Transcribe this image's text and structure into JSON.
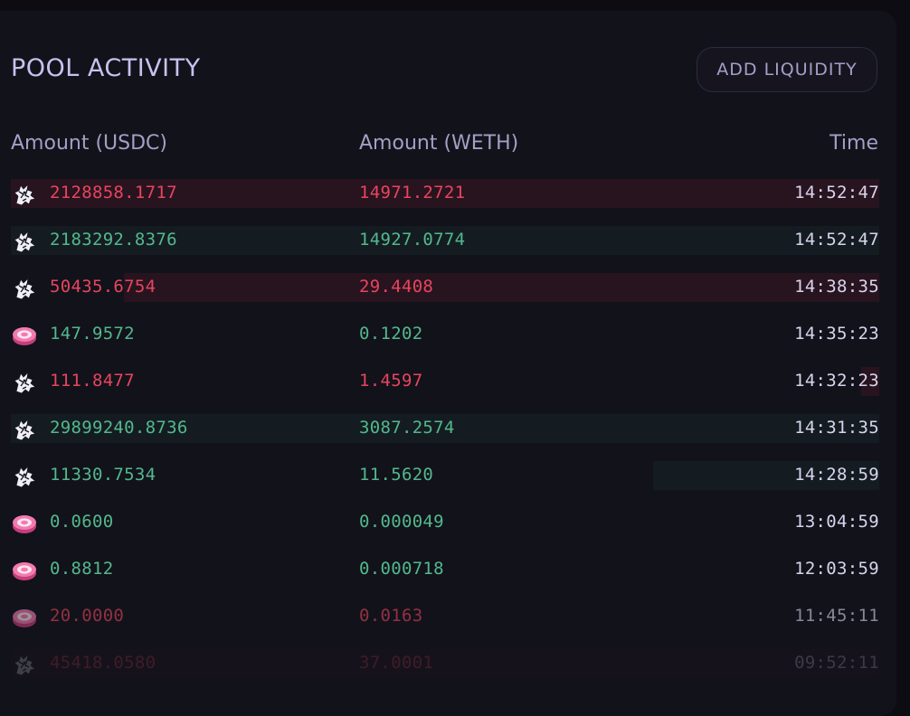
{
  "header": {
    "title": "POOL ACTIVITY",
    "add_liquidity_label": "ADD LIQUIDITY"
  },
  "table": {
    "columns": [
      "Amount (USDC)",
      "Amount (WETH)",
      "Time"
    ],
    "rows": [
      {
        "icon": "unicorn-icon",
        "usdc": "2128858.1717",
        "weth": "14971.2721",
        "time": "14:52:47",
        "side": "sell"
      },
      {
        "icon": "unicorn-icon",
        "usdc": "2183292.8376",
        "weth": "14927.0774",
        "time": "14:52:47",
        "side": "buy"
      },
      {
        "icon": "unicorn-icon",
        "usdc": "50435.6754",
        "weth": "29.4408",
        "time": "14:38:35",
        "side": "sell"
      },
      {
        "icon": "pink-disc-icon",
        "usdc": "147.9572",
        "weth": "0.1202",
        "time": "14:35:23",
        "side": "buy"
      },
      {
        "icon": "unicorn-icon",
        "usdc": "111.8477",
        "weth": "1.4597",
        "time": "14:32:23",
        "side": "sell"
      },
      {
        "icon": "unicorn-icon",
        "usdc": "29899240.8736",
        "weth": "3087.2574",
        "time": "14:31:35",
        "side": "buy"
      },
      {
        "icon": "unicorn-icon",
        "usdc": "11330.7534",
        "weth": "11.5620",
        "time": "14:28:59",
        "side": "buy"
      },
      {
        "icon": "pink-disc-icon",
        "usdc": "0.0600",
        "weth": "0.000049",
        "time": "13:04:59",
        "side": "buy"
      },
      {
        "icon": "pink-disc-icon",
        "usdc": "0.8812",
        "weth": "0.000718",
        "time": "12:03:59",
        "side": "buy"
      },
      {
        "icon": "pink-disc-icon",
        "usdc": "20.0000",
        "weth": "0.0163",
        "time": "11:45:11",
        "side": "sell"
      },
      {
        "icon": "unicorn-icon",
        "usdc": "45418.0580",
        "weth": "37.0001",
        "time": "09:52:11",
        "side": "sell"
      }
    ]
  },
  "colors": {
    "sell": "#e7455f",
    "buy": "#53b88d"
  }
}
